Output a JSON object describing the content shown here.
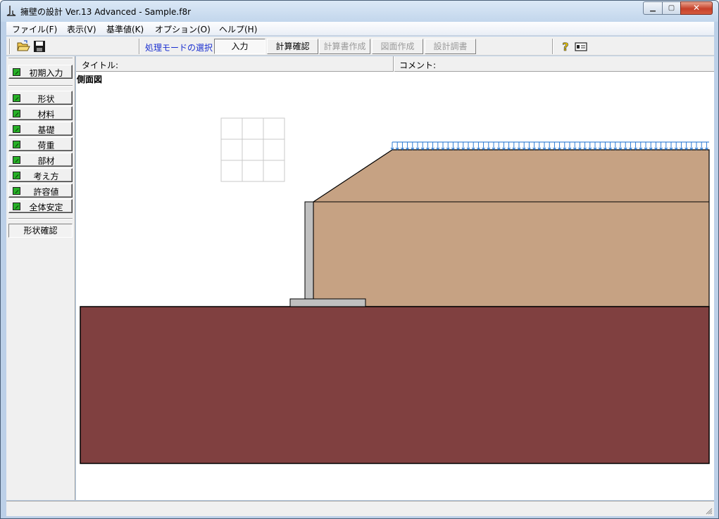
{
  "window": {
    "title": "擁壁の設計 Ver.13 Advanced  - Sample.f8r",
    "icons": {
      "app": "retaining-wall-app-icon",
      "minimize": "minimize-icon",
      "maximize": "maximize-icon",
      "close": "close-icon"
    }
  },
  "menu": {
    "items": [
      {
        "label": "ファイル(F)"
      },
      {
        "label": "表示(V)"
      },
      {
        "label": "基準値(K)"
      },
      {
        "label": "オプション(O)"
      },
      {
        "label": "ヘルプ(H)"
      }
    ]
  },
  "toolbar": {
    "icons": {
      "open": "folder-open-icon",
      "save": "floppy-save-icon",
      "help": "question-mark-help-icon",
      "info": "id-card-info-icon"
    },
    "mode_label": "処理モードの選択",
    "modes": [
      {
        "label": "入力",
        "state": "active"
      },
      {
        "label": "計算確認",
        "state": "enabled"
      },
      {
        "label": "計算書作成",
        "state": "disabled"
      },
      {
        "label": "図面作成",
        "state": "disabled"
      },
      {
        "label": "設計調書",
        "state": "disabled"
      }
    ]
  },
  "sidebar": {
    "initial": {
      "label": "初期入力",
      "checked": true
    },
    "items": [
      {
        "label": "形状",
        "checked": true
      },
      {
        "label": "材料",
        "checked": true
      },
      {
        "label": "基礎",
        "checked": true
      },
      {
        "label": "荷重",
        "checked": true
      },
      {
        "label": "部材",
        "checked": true
      },
      {
        "label": "考え方",
        "checked": true
      },
      {
        "label": "許容値",
        "checked": true
      },
      {
        "label": "全体安定",
        "checked": true
      }
    ],
    "confirm": {
      "label": "形状確認"
    }
  },
  "info": {
    "title_label": "タイトル:",
    "title_value": "",
    "comment_label": "コメント:",
    "comment_value": ""
  },
  "drawing": {
    "view_title": "側面図",
    "colors": {
      "backfill": "#c6a283",
      "foundation": "#804040",
      "wall": "#c0c0c0",
      "load_arrow": "#1a6fd0",
      "grid": "#c8c8c8"
    }
  },
  "statusbar": {
    "text": ""
  }
}
